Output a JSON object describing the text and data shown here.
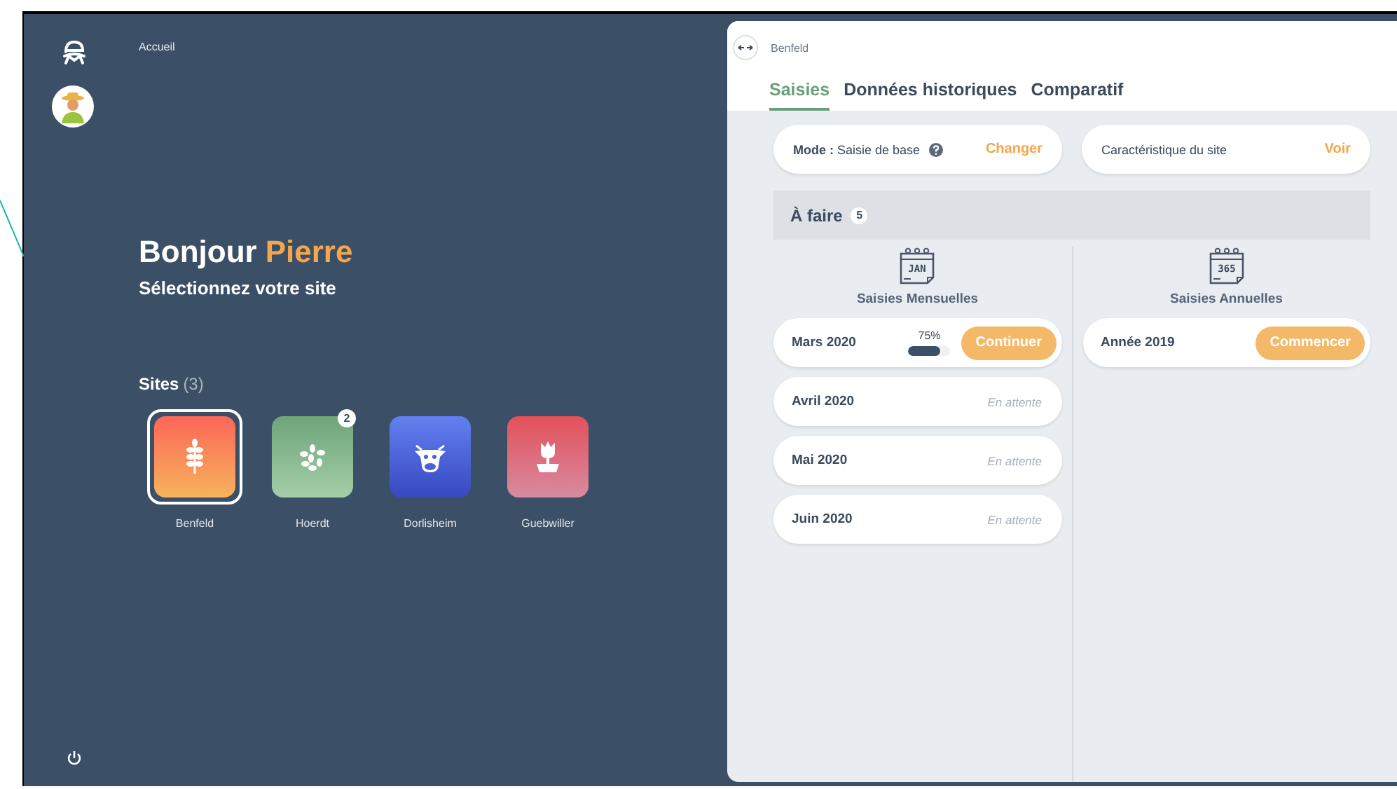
{
  "nav": {
    "breadcrumb": "Accueil"
  },
  "greeting": {
    "hello": "Bonjour",
    "name": "Pierre",
    "subtitle": "Sélectionnez votre site"
  },
  "sites": {
    "title": "Sites",
    "count": "(3)",
    "items": [
      {
        "name": "Benfeld",
        "kind": "wheat",
        "selected": true
      },
      {
        "name": "Hoerdt",
        "kind": "seeds",
        "badge": "2",
        "selected": false
      },
      {
        "name": "Dorlisheim",
        "kind": "cow",
        "selected": false
      },
      {
        "name": "Guebwiller",
        "kind": "tulip",
        "selected": false
      }
    ]
  },
  "panel": {
    "site": "Benfeld",
    "tabs": [
      {
        "label": "Saisies",
        "selected": true
      },
      {
        "label": "Données historiques",
        "selected": false
      },
      {
        "label": "Comparatif",
        "selected": false
      }
    ],
    "mode": {
      "text": "**Mode :** Saisie de base",
      "action": "Changer"
    },
    "characteristics": {
      "label": "Caractéristique du site",
      "action": "Voir"
    },
    "todo": {
      "title": "À faire",
      "count": "5"
    },
    "columns": [
      {
        "calendar": "JAN",
        "title": "Saisies Mensuelles",
        "entries": [
          {
            "label": "Mars 2020",
            "kind": "progress",
            "percent": "75%",
            "level": 0.75,
            "action": "Continuer"
          },
          {
            "label": "Avril 2020",
            "kind": "pending",
            "status": "En attente"
          },
          {
            "label": "Mai 2020",
            "kind": "pending",
            "status": "En attente"
          },
          {
            "label": "Juin 2020",
            "kind": "pending",
            "status": "En attente"
          }
        ]
      },
      {
        "calendar": "365",
        "title": "Saisies Annuelles",
        "entries": [
          {
            "label": "Année 2019",
            "kind": "start",
            "action": "Commencer"
          }
        ]
      }
    ]
  }
}
